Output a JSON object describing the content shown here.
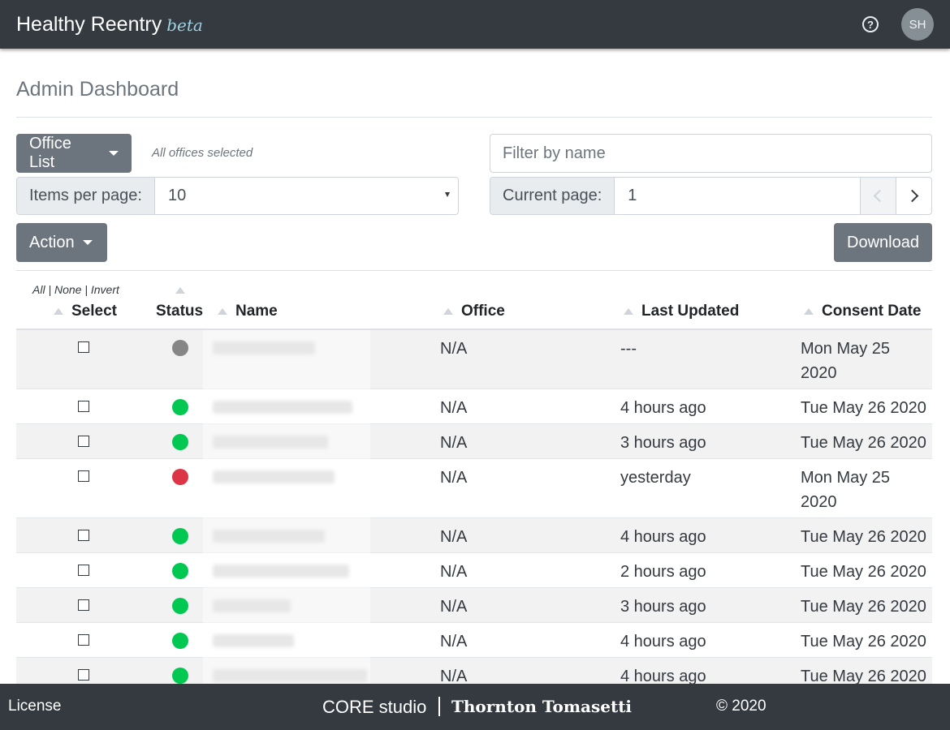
{
  "navbar": {
    "app_name": "Healthy Reentry",
    "beta_label": "beta",
    "help_icon": "question-circle-icon",
    "avatar_initials": "SH"
  },
  "page": {
    "title": "Admin Dashboard"
  },
  "controls": {
    "office_button": "Office List",
    "offices_note": "All offices selected",
    "filter_placeholder": "Filter by name",
    "items_per_page_label": "Items per page:",
    "items_per_page_value": "10",
    "current_page_label": "Current page:",
    "current_page_value": "1",
    "prev_icon": "chevron-left-icon",
    "next_icon": "chevron-right-icon",
    "action_button": "Action",
    "download_button": "Download"
  },
  "table": {
    "selection_links": "All | None | Invert",
    "columns": {
      "select": "Select",
      "status": "Status",
      "name": "Name",
      "office": "Office",
      "last_updated": "Last Updated",
      "consent_date": "Consent Date"
    },
    "status_colors": {
      "grey": "#868686",
      "green": "#00c851",
      "red": "#dc3545"
    },
    "rows": [
      {
        "status": "grey",
        "office": "N/A",
        "last_updated": "---",
        "consent_date": "Mon May 25 2020"
      },
      {
        "status": "green",
        "office": "N/A",
        "last_updated": "4 hours ago",
        "consent_date": "Tue May 26 2020"
      },
      {
        "status": "green",
        "office": "N/A",
        "last_updated": "3 hours ago",
        "consent_date": "Tue May 26 2020"
      },
      {
        "status": "red",
        "office": "N/A",
        "last_updated": "yesterday",
        "consent_date": "Mon May 25 2020"
      },
      {
        "status": "green",
        "office": "N/A",
        "last_updated": "4 hours ago",
        "consent_date": "Tue May 26 2020"
      },
      {
        "status": "green",
        "office": "N/A",
        "last_updated": "2 hours ago",
        "consent_date": "Tue May 26 2020"
      },
      {
        "status": "green",
        "office": "N/A",
        "last_updated": "3 hours ago",
        "consent_date": "Tue May 26 2020"
      },
      {
        "status": "green",
        "office": "N/A",
        "last_updated": "4 hours ago",
        "consent_date": "Tue May 26 2020"
      },
      {
        "status": "green",
        "office": "N/A",
        "last_updated": "4 hours ago",
        "consent_date": "Tue May 26 2020"
      }
    ]
  },
  "footer": {
    "license": "License",
    "core": "CORE studio",
    "company": "Thornton Tomasetti",
    "copyright": "© 2020"
  }
}
